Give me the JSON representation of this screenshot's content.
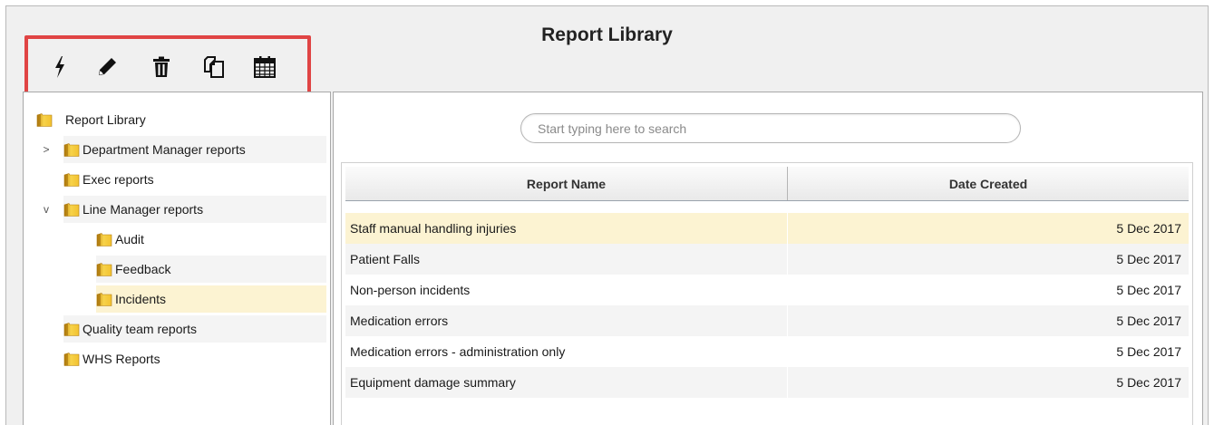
{
  "window": {
    "title": "Report Library"
  },
  "toolbar": {
    "icons": [
      "lightning-icon",
      "pencil-icon",
      "trash-icon",
      "copy-icon",
      "calendar-icon"
    ]
  },
  "tree": {
    "root": "Report Library",
    "items": [
      {
        "label": "Department Manager reports",
        "expander": ">"
      },
      {
        "label": "Exec reports"
      },
      {
        "label": "Line Manager reports",
        "expander": "v"
      },
      {
        "label": "Audit"
      },
      {
        "label": "Feedback"
      },
      {
        "label": "Incidents"
      },
      {
        "label": "Quality team reports"
      },
      {
        "label": "WHS Reports"
      }
    ]
  },
  "search": {
    "placeholder": "Start typing here to search",
    "value": ""
  },
  "table": {
    "columns": [
      "Report Name",
      "Date Created"
    ],
    "rows": [
      {
        "name": "Staff manual handling injuries",
        "date": "5 Dec 2017"
      },
      {
        "name": "Patient Falls",
        "date": "5 Dec 2017"
      },
      {
        "name": "Non-person incidents",
        "date": "5 Dec 2017"
      },
      {
        "name": "Medication errors",
        "date": "5 Dec 2017"
      },
      {
        "name": "Medication errors - administration only",
        "date": "5 Dec 2017"
      },
      {
        "name": "Equipment damage summary",
        "date": "5 Dec 2017"
      }
    ]
  },
  "colors": {
    "highlight_box": "#e04444",
    "selected_row": "#fcf3d2",
    "folder": "#f2c230"
  }
}
